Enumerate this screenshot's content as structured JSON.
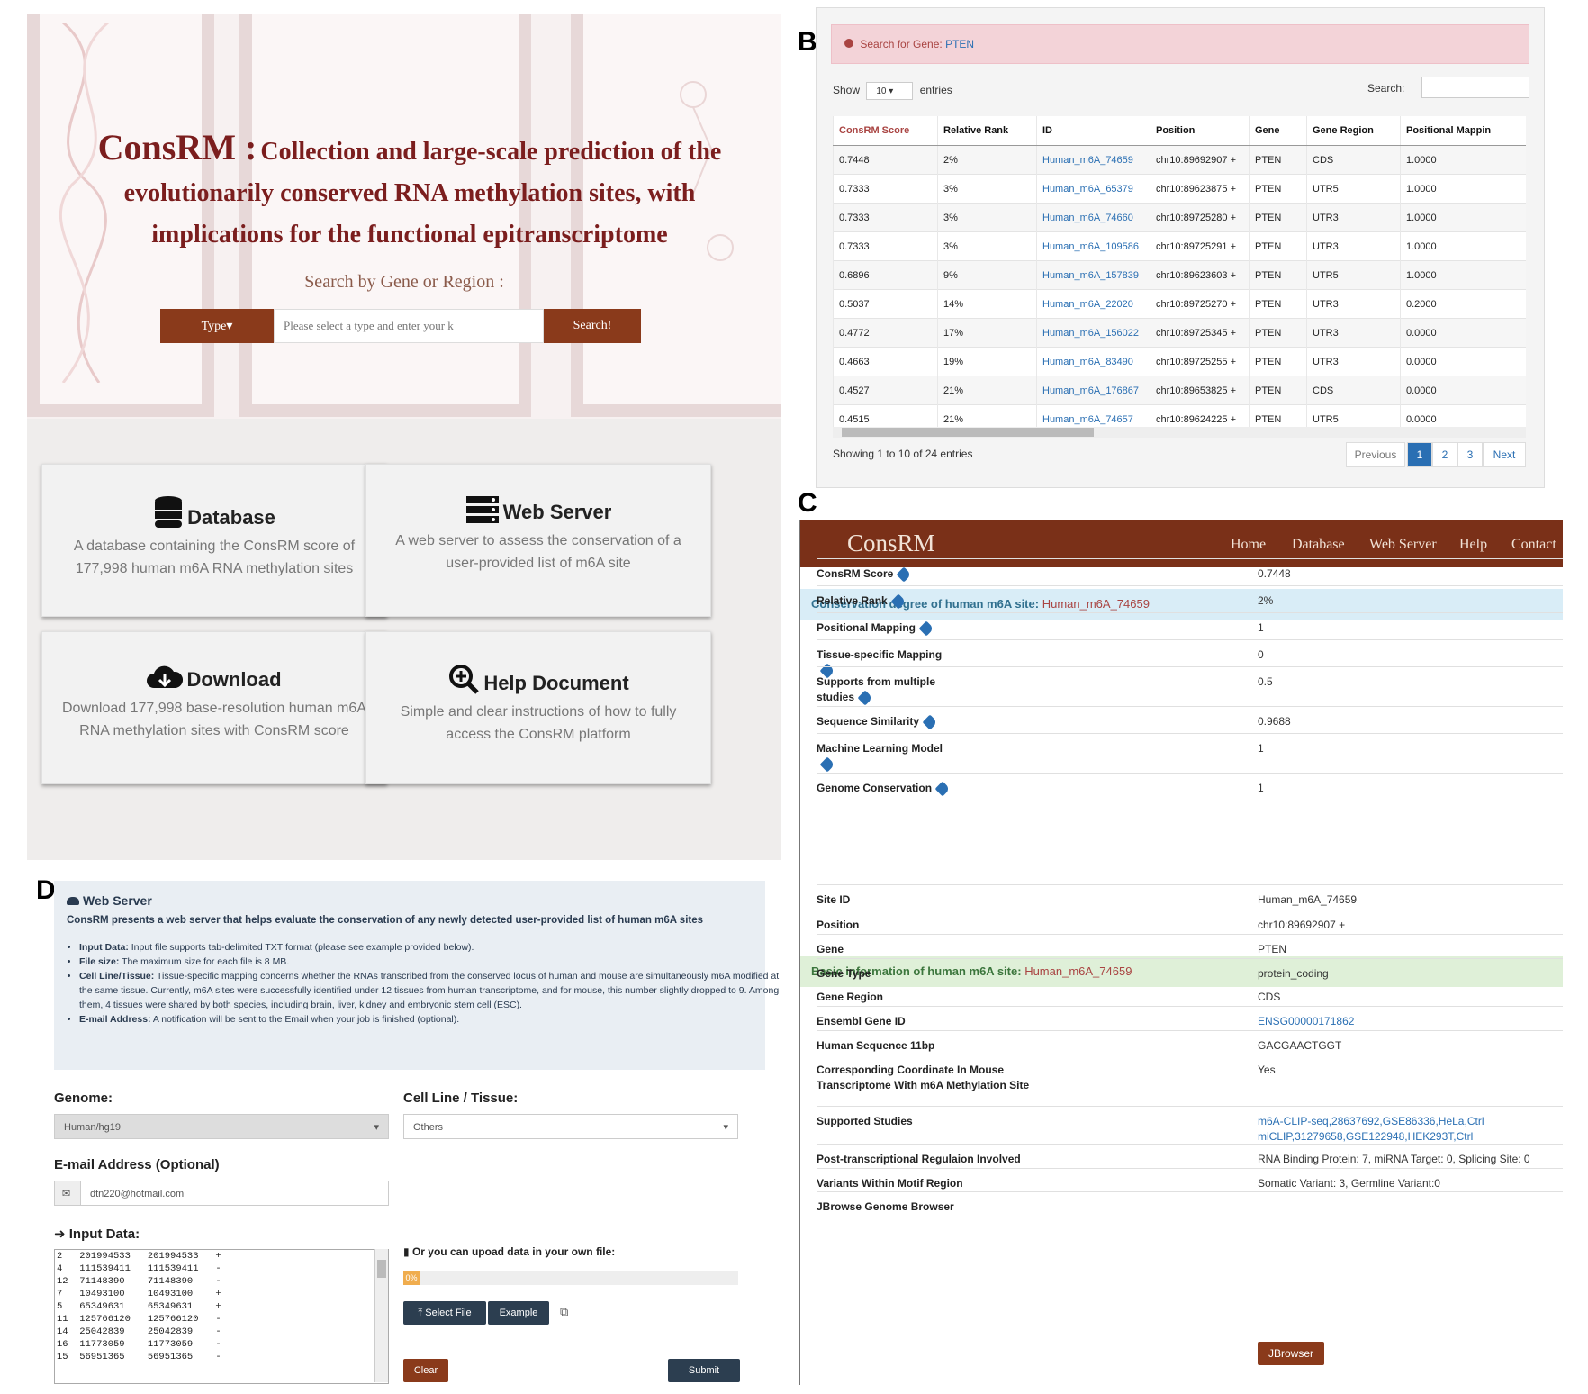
{
  "panel_labels": {
    "a": "A",
    "b": "B",
    "c": "C",
    "d": "D"
  },
  "panelA": {
    "brand": "ConsRM :",
    "title_rest": "Collection and large-scale prediction of the evolutionarily conserved RNA methylation sites, with implications for the functional epitranscriptome",
    "search_label": "Search by Gene or Region :",
    "type_button": "Type",
    "search_placeholder": "Please select a type and enter your k",
    "search_button": "Search!",
    "cards": [
      {
        "title": "Database",
        "desc": "A database containing the ConsRM score of 177,998 human m6A RNA methylation sites",
        "icon": "database-icon"
      },
      {
        "title": "Web Server",
        "desc": "A web server to assess the conservation of a user-provided list of m6A site",
        "icon": "server-icon"
      },
      {
        "title": "Download",
        "desc": "Download 177,998 base-resolution human m6A RNA methylation sites with ConsRM score",
        "icon": "cloud-download-icon"
      },
      {
        "title": "Help Document",
        "desc": "Simple and clear instructions of how to fully access the ConsRM platform",
        "icon": "zoom-in-icon"
      }
    ]
  },
  "panelB": {
    "alert_prefix": "Search for Gene:",
    "alert_gene": "PTEN",
    "show": "Show",
    "show_value": "10",
    "entries": "entries",
    "search": "Search:",
    "columns": [
      "ConsRM Score",
      "Relative Rank",
      "ID",
      "Position",
      "Gene",
      "Gene Region",
      "Positional Mappin"
    ],
    "rows": [
      [
        "0.7448",
        "2%",
        "Human_m6A_74659",
        "chr10:89692907 +",
        "PTEN",
        "CDS",
        "1.0000"
      ],
      [
        "0.7333",
        "3%",
        "Human_m6A_65379",
        "chr10:89623875 +",
        "PTEN",
        "UTR5",
        "1.0000"
      ],
      [
        "0.7333",
        "3%",
        "Human_m6A_74660",
        "chr10:89725280 +",
        "PTEN",
        "UTR3",
        "1.0000"
      ],
      [
        "0.7333",
        "3%",
        "Human_m6A_109586",
        "chr10:89725291 +",
        "PTEN",
        "UTR3",
        "1.0000"
      ],
      [
        "0.6896",
        "9%",
        "Human_m6A_157839",
        "chr10:89623603 +",
        "PTEN",
        "UTR5",
        "1.0000"
      ],
      [
        "0.5037",
        "14%",
        "Human_m6A_22020",
        "chr10:89725270 +",
        "PTEN",
        "UTR3",
        "0.2000"
      ],
      [
        "0.4772",
        "17%",
        "Human_m6A_156022",
        "chr10:89725345 +",
        "PTEN",
        "UTR3",
        "0.0000"
      ],
      [
        "0.4663",
        "19%",
        "Human_m6A_83490",
        "chr10:89725255 +",
        "PTEN",
        "UTR3",
        "0.0000"
      ],
      [
        "0.4527",
        "21%",
        "Human_m6A_176867",
        "chr10:89653825 +",
        "PTEN",
        "CDS",
        "0.0000"
      ],
      [
        "0.4515",
        "21%",
        "Human_m6A_74657",
        "chr10:89624225 +",
        "PTEN",
        "UTR5",
        "0.0000"
      ]
    ],
    "footer": "Showing 1 to 10 of 24 entries",
    "pages": [
      "Previous",
      "1",
      "2",
      "3",
      "Next"
    ]
  },
  "panelC": {
    "brand": "ConsRM",
    "nav": [
      "Home",
      "Database",
      "Web Server",
      "Help",
      "Contact"
    ],
    "sec1_label": "Conservation degree of human m6A site:",
    "sec1_id": "Human_m6A_74659",
    "sec1_rows": [
      {
        "k": "ConsRM Score",
        "v": "0.7448"
      },
      {
        "k": "Relative Rank",
        "v": "2%"
      },
      {
        "k": "Positional Mapping",
        "v": "1"
      },
      {
        "k": "Tissue-specific Mapping",
        "v": "0"
      },
      {
        "k": "Supports from multiple studies",
        "v": "0.5"
      },
      {
        "k": "Sequence Similarity",
        "v": "0.9688"
      },
      {
        "k": "Machine Learning Model",
        "v": "1"
      },
      {
        "k": "Genome Conservation",
        "v": "1"
      }
    ],
    "sec2_label": "Basic information of human m6A site:",
    "sec2_id": "Human_m6A_74659",
    "sec2_rows": [
      {
        "k": "Site ID",
        "v": "Human_m6A_74659"
      },
      {
        "k": "Position",
        "v": "chr10:89692907 +"
      },
      {
        "k": "Gene",
        "v": "PTEN"
      },
      {
        "k": "Gene Type",
        "v": "protein_coding"
      },
      {
        "k": "Gene Region",
        "v": "CDS"
      },
      {
        "k": "Ensembl Gene ID",
        "v": "ENSG00000171862"
      },
      {
        "k": "Human Sequence 11bp",
        "v": "GACGAACTGGT"
      },
      {
        "k": "Corresponding Coordinate In Mouse Transcriptome With m6A Methylation Site",
        "v": "Yes"
      },
      {
        "k": "Supported Studies",
        "v": "m6A-CLIP-seq,28637692,GSE86336,HeLa,Ctrl miCLIP,31279658,GSE122948,HEK293T,Ctrl"
      },
      {
        "k": "Post-transcriptional Regulaion Involved",
        "v": "RNA Binding Protein: 7, miRNA Target: 0, Splicing Site: 0"
      },
      {
        "k": "Variants Within Motif Region",
        "v": "Somatic Variant: 3, Germline Variant:0"
      },
      {
        "k": "JBrowse Genome Browser",
        "v": ""
      }
    ],
    "jbrowse_button": "JBrowser"
  },
  "panelD": {
    "title": "Web Server",
    "intro": "ConsRM presents a web server that helps evaluate the conservation of any newly detected user-provided list of human m6A sites",
    "bullets": [
      {
        "k": "Input Data:",
        "v": "Input file supports tab-delimited TXT format (please see example provided below)."
      },
      {
        "k": "File size:",
        "v": "The maximum size for each file is 8 MB."
      },
      {
        "k": "Cell Line/Tissue:",
        "v": "Tissue-specific mapping concerns whether the RNAs transcribed from the conserved locus of human and mouse are simultaneously m6A modified at the same tissue. Currently, m6A sites were successfully identified under 12 tissues from human transcriptome, and for mouse, this number slightly dropped to 9. Among them, 4 tissues were shared by both species, including brain, liver, kidney and embryonic stem cell (ESC)."
      },
      {
        "k": "E-mail Address:",
        "v": "A notification will be sent to the Email when your job is finished (optional)."
      }
    ],
    "genome_label": "Genome:",
    "genome_value": "Human/hg19",
    "cell_label": "Cell Line / Tissue:",
    "cell_value": "Others",
    "email_label": "E-mail Address (Optional)",
    "email_value": "dtn220@hotmail.com",
    "input_label": "Input Data:",
    "input_lines": [
      "2   201994533   201994533   +",
      "4   111539411   111539411   -",
      "12  71148390    71148390    -",
      "7   10493100    10493100    +",
      "5   65349631    65349631    +",
      "11  125766120   125766120   -",
      "14  25042839    25042839    -",
      "16  11773059    11773059    -",
      "15  56951365    56951365    -"
    ],
    "upload_label": "Or you can upoad data in your own file:",
    "progress": "0%",
    "progress_value": 0,
    "select_file": "Select File",
    "example": "Example",
    "clear": "Clear",
    "submit": "Submit"
  }
}
